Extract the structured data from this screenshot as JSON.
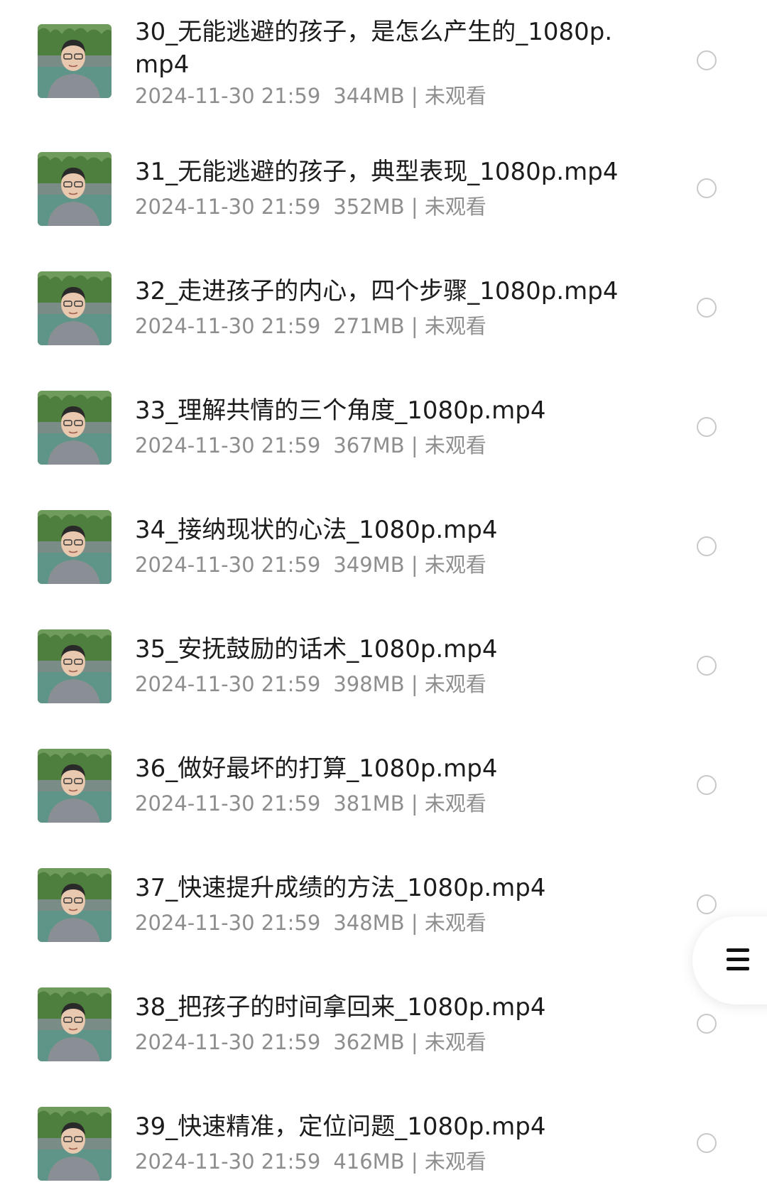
{
  "files": [
    {
      "title": "30_无能逃避的孩子，是怎么产生的_1080p.mp4",
      "date": "2024-11-30 21:59",
      "size": "344MB",
      "status": "未观看"
    },
    {
      "title": "31_无能逃避的孩子，典型表现_1080p.mp4",
      "date": "2024-11-30 21:59",
      "size": "352MB",
      "status": "未观看"
    },
    {
      "title": "32_走进孩子的内心，四个步骤_1080p.mp4",
      "date": "2024-11-30 21:59",
      "size": "271MB",
      "status": "未观看"
    },
    {
      "title": "33_理解共情的三个角度_1080p.mp4",
      "date": "2024-11-30 21:59",
      "size": "367MB",
      "status": "未观看"
    },
    {
      "title": "34_接纳现状的心法_1080p.mp4",
      "date": "2024-11-30 21:59",
      "size": "349MB",
      "status": "未观看"
    },
    {
      "title": "35_安抚鼓励的话术_1080p.mp4",
      "date": "2024-11-30 21:59",
      "size": "398MB",
      "status": "未观看"
    },
    {
      "title": "36_做好最坏的打算_1080p.mp4",
      "date": "2024-11-30 21:59",
      "size": "381MB",
      "status": "未观看"
    },
    {
      "title": "37_快速提升成绩的方法_1080p.mp4",
      "date": "2024-11-30 21:59",
      "size": "348MB",
      "status": "未观看"
    },
    {
      "title": "38_把孩子的时间拿回来_1080p.mp4",
      "date": "2024-11-30 21:59",
      "size": "362MB",
      "status": "未观看"
    },
    {
      "title": "39_快速精准，定位问题_1080p.mp4",
      "date": "2024-11-30 21:59",
      "size": "416MB",
      "status": "未观看"
    }
  ],
  "separator": "|",
  "fab": {
    "icon": "menu-icon"
  },
  "colors": {
    "title": "#1c1c1c",
    "meta": "#8e8e8e",
    "radio_border": "#c9c9c9",
    "background": "#ffffff"
  }
}
